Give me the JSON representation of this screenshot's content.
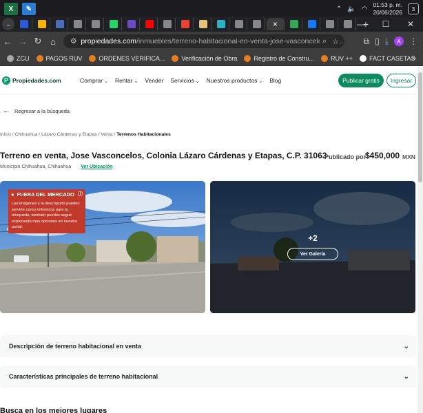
{
  "taskbar": {
    "apps": [
      {
        "name": "excel",
        "glyph": "X",
        "color": "#1d6f42"
      },
      {
        "name": "paint",
        "glyph": "✎",
        "color": "#2b7cd3"
      }
    ],
    "clock_time": "01:53 p. m.",
    "clock_date": "20/06/2026",
    "notifications": "3"
  },
  "tabs": {
    "favicons": [
      "#2b5bd7",
      "#f4b400",
      "#4b6cb7",
      "#888888",
      "#888888",
      "#25d366",
      "#6a4bc4",
      "#ff0000",
      "#888888",
      "#ea4335",
      "#e8c27a",
      "#2fb0c4",
      "#888888",
      "#888888"
    ],
    "active_close": "×",
    "after_active": [
      "#34a853",
      "#1877f2",
      "#888888",
      "#888888"
    ],
    "new_tab": "+"
  },
  "window_controls": {
    "minimize": "—",
    "maximize": "☐",
    "close": "✕"
  },
  "address": {
    "host": "propiedades.com",
    "path": "/inmuebles/terreno-habitacional-en-venta-jose-vasconcelos-laz..."
  },
  "profile_initial": "A",
  "bookmarks": [
    {
      "label": "ZCU",
      "color": "#aaaaaa"
    },
    {
      "label": "PAGOS RUV",
      "color": "#e67e22"
    },
    {
      "label": "ORDENES VERIFICA...",
      "color": "#e67e22"
    },
    {
      "label": "Verificación de Obra",
      "color": "#e67e22"
    },
    {
      "label": "Registro de Constru...",
      "color": "#e67e22"
    },
    {
      "label": "RUV ++",
      "color": "#e67e22"
    },
    {
      "label": "FACT CASETAS",
      "color": "#ffffff"
    }
  ],
  "bookmarks_more": "»",
  "site": {
    "logo_text": "Propiedades.com",
    "nav": [
      {
        "label": "Comprar",
        "chevron": true
      },
      {
        "label": "Rentar",
        "chevron": true
      },
      {
        "label": "Vender",
        "chevron": false
      },
      {
        "label": "Servicios",
        "chevron": true
      },
      {
        "label": "Nuestros productos",
        "chevron": true
      },
      {
        "label": "Blog",
        "chevron": false
      }
    ],
    "publish_label": "Publicar gratis",
    "login_label": "Ingresar"
  },
  "back_label": "Regresar a la búsqueda",
  "breadcrumb": {
    "path": "Inicio / Chihuahua / Lázaro Cárdenas y Etapas / Venta / ",
    "current": "Terrenos Habitacionales"
  },
  "listing": {
    "title": "Terreno en venta, Jose Vasconcelos, Colonia Lázaro Cárdenas y Etapas, C.P. 31063",
    "municipality": "Municipio Chihuahua, Chihuahua",
    "location_link": "Ver Ubicación",
    "price_label": "Publicado por",
    "price": "$450,000",
    "currency": "MXN"
  },
  "gallery": {
    "off_market_label": "FUERA DEL MERCADO",
    "off_market_note": "Las imágenes y la descripción pueden servirte como referencia para tu búsqueda, también puedes seguir explorando más opciones en nuestro portal.",
    "extra_count": "+2",
    "view_gallery_label": "Ver Galería"
  },
  "accordions": [
    "Descripción de terreno habitacional en venta",
    "Características principales de terreno habitacional"
  ],
  "section_title": "Busca en los mejores lugares"
}
